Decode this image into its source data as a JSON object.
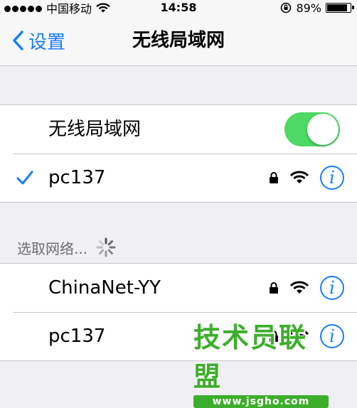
{
  "status_bar": {
    "carrier": "中国移动",
    "time": "14:58",
    "battery_percent": "89%",
    "battery_level": 0.89
  },
  "navbar": {
    "back_label": "设置",
    "title": "无线局域网"
  },
  "wifi_toggle": {
    "label": "无线局域网",
    "on": true,
    "color": "#4cd964"
  },
  "connected_network": {
    "name": "pc137",
    "secured": true
  },
  "section_header": "选取网络...",
  "networks": [
    {
      "name": "ChinaNet-YY",
      "secured": true
    },
    {
      "name": "pc137",
      "secured": true
    }
  ],
  "watermark": {
    "title": "技术员联盟",
    "url": "www.jsgho.com"
  },
  "colors": {
    "accent": "#157efb",
    "background": "#efeff4",
    "toggle_on": "#4cd964",
    "watermark": "#3dae2b"
  }
}
